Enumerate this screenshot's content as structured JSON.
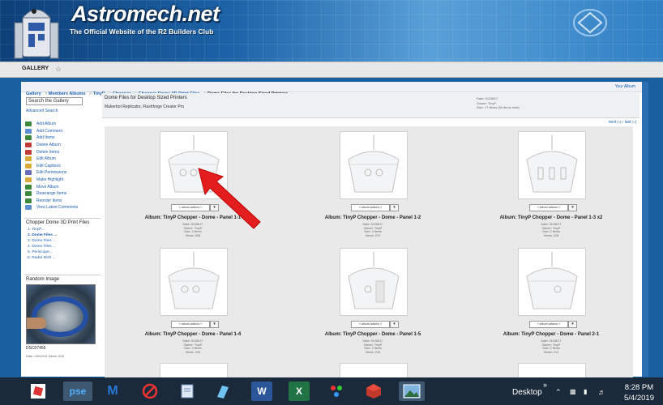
{
  "header": {
    "logo_text": "Astromech.net",
    "tagline": "The Official Website of the R2 Builders Club"
  },
  "nav": {
    "gallery": "GALLERY"
  },
  "breadcrumb": {
    "items": [
      "Gallery",
      "Members Albums",
      "TinyP",
      "Chopper",
      "Chopper Dome 3D Print Files"
    ],
    "current": "Dome Files for Desktop Sized Printers",
    "your_album": "Your Album"
  },
  "sidebar": {
    "search_placeholder": "Search the Gallery",
    "advanced_search": "Advanced Search",
    "actions": [
      {
        "label": "Add Album",
        "color": "#3b8a3b"
      },
      {
        "label": "Add Comment",
        "color": "#5b8fd0"
      },
      {
        "label": "Add Items",
        "color": "#3b8a3b"
      },
      {
        "label": "Delete Album",
        "color": "#c03a3a"
      },
      {
        "label": "Delete Items",
        "color": "#c03a3a"
      },
      {
        "label": "Edit Album",
        "color": "#d9a93a"
      },
      {
        "label": "Edit Captions",
        "color": "#d9a93a"
      },
      {
        "label": "Edit Permissions",
        "color": "#6a6ab8"
      },
      {
        "label": "Make Highlight",
        "color": "#d9a93a"
      },
      {
        "label": "Move Album",
        "color": "#3b8a3b"
      },
      {
        "label": "Rearrange Items",
        "color": "#3b8a3b"
      },
      {
        "label": "Reorder Items",
        "color": "#3b8a3b"
      },
      {
        "label": "View Latest Comments",
        "color": "#5b8fd0"
      }
    ],
    "tree_title": "Chopper Dome 3D Print Files",
    "tree_items": [
      "1. TinyP...",
      "2. Dome Files ...",
      "3. Dome Files ...",
      "4. Dome Files ...",
      "5. Periscope...",
      "6. Radar Dish ..."
    ],
    "random_title": "Random Image",
    "random_name": "DSC07456",
    "random_meta": "Date: 04/02/13   Views: 828"
  },
  "album": {
    "title": "Dome Files for Desktop Sized Printers",
    "description": "Makerbot Replicator, Flashforge Creator Pro",
    "meta": [
      "Date: 01/08/17",
      "Owner: TinyP",
      "Size: 17 items (50 items total)"
    ],
    "pager": "next ▷▷ last ▷|"
  },
  "items": [
    {
      "title": "Album: TinyP Chopper - Dome - Panel 1-1",
      "meta": [
        "Date: 01/08/17",
        "Owner: TinyP",
        "Size: 2 items",
        "Views: 528"
      ],
      "actions": "« album actions »"
    },
    {
      "title": "Album: TinyP Chopper - Dome - Panel 1-2",
      "meta": [
        "Date: 01/08/17",
        "Owner: TinyP",
        "Size: 2 items",
        "Views: 272"
      ],
      "actions": "« album actions »"
    },
    {
      "title": "Album: TinyP Chopper - Dome - Panel 1-3 x2",
      "meta": [
        "Date: 01/08/17",
        "Owner: TinyP",
        "Size: 2 items",
        "Views: 226"
      ],
      "actions": "« album actions »"
    },
    {
      "title": "Album: TinyP Chopper - Dome - Panel 1-4",
      "meta": [
        "Date: 01/08/17",
        "Owner: TinyP",
        "Size: 2 items",
        "Views: 226"
      ],
      "actions": "« album actions »"
    },
    {
      "title": "Album: TinyP Chopper - Dome - Panel 1-5",
      "meta": [
        "Date: 01/08/17",
        "Owner: TinyP",
        "Size: 2 items",
        "Views: 226"
      ],
      "actions": "« album actions »"
    },
    {
      "title": "Album: TinyP Chopper - Dome - Panel 2-1",
      "meta": [
        "Date: 01/08/17",
        "Owner: TinyP",
        "Size: 2 items",
        "Views: 212"
      ],
      "actions": "« album actions »"
    }
  ],
  "taskbar": {
    "apps": [
      "Roblox",
      "pse",
      "Malwarebytes",
      "Blocked",
      "Notepad",
      "Files",
      "Word",
      "Excel",
      "Photo Viewer",
      "3D",
      "Photos"
    ],
    "pse_label": "pse",
    "desktop_label": "Desktop",
    "time": "8:28 PM",
    "date": "5/4/2019"
  }
}
